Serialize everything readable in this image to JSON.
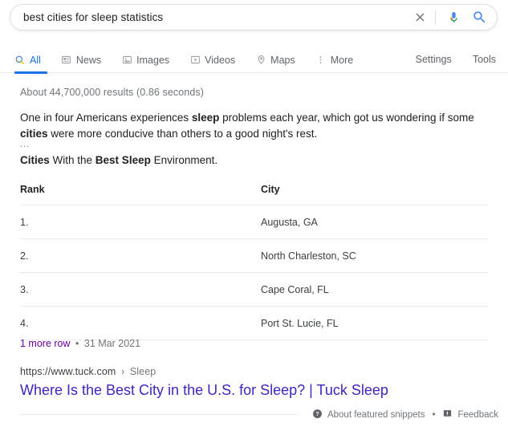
{
  "search": {
    "query": "best cities for sleep statistics",
    "placeholder": "Search",
    "clear_icon": "close-x-icon",
    "mic_icon": "microphone-icon",
    "submit_icon": "search-magnifier-icon",
    "accent_blue": "#4285F4"
  },
  "nav": {
    "tabs": [
      {
        "label": "All",
        "icon": "search-magnifier-icon",
        "active": true
      },
      {
        "label": "News",
        "icon": "newspaper-icon",
        "active": false
      },
      {
        "label": "Images",
        "icon": "image-icon",
        "active": false
      },
      {
        "label": "Videos",
        "icon": "video-play-icon",
        "active": false
      },
      {
        "label": "Maps",
        "icon": "map-pin-icon",
        "active": false
      },
      {
        "label": "More",
        "icon": "more-vertical-dots-icon",
        "active": false
      }
    ],
    "settings_label": "Settings",
    "tools_label": "Tools",
    "active_color": "#1a73e8"
  },
  "results": {
    "stats": "About 44,700,000 results (0.86 seconds)"
  },
  "snippet": {
    "paragraph_parts": [
      {
        "text": "One in four Americans experiences ",
        "bold": false
      },
      {
        "text": "sleep",
        "bold": true
      },
      {
        "text": " problems each year, which got us wondering if some ",
        "bold": false
      },
      {
        "text": "cities",
        "bold": true
      },
      {
        "text": " were more conducive than others to a good night's rest.",
        "bold": false
      }
    ],
    "ellipsis": "...",
    "subheading_parts": [
      {
        "text": "Cities",
        "bold": true
      },
      {
        "text": " With the ",
        "bold": false
      },
      {
        "text": "Best Sleep",
        "bold": true
      },
      {
        "text": " Environment.",
        "bold": false
      }
    ]
  },
  "table": {
    "headers": [
      "Rank",
      "City"
    ],
    "rows": [
      [
        "1.",
        "Augusta, GA"
      ],
      [
        "2.",
        "North Charleston, SC"
      ],
      [
        "3.",
        "Cape Coral, FL"
      ],
      [
        "4.",
        "Port St. Lucie, FL"
      ]
    ],
    "more_row_link": "1 more row",
    "separator": "•",
    "date": "31 Mar 2021",
    "link_color": "#660099"
  },
  "source": {
    "url_domain": "https://www.tuck.com",
    "crumb_separator": "›",
    "url_crumb": "Sleep",
    "title": "Where Is the Best City in the U.S. for Sleep? | Tuck Sleep",
    "title_color": "#3f26bf"
  },
  "footer": {
    "about_icon": "help-question-circle-icon",
    "about_label": "About featured snippets",
    "separator": "•",
    "feedback_icon": "feedback-flag-icon",
    "feedback_label": "Feedback"
  }
}
